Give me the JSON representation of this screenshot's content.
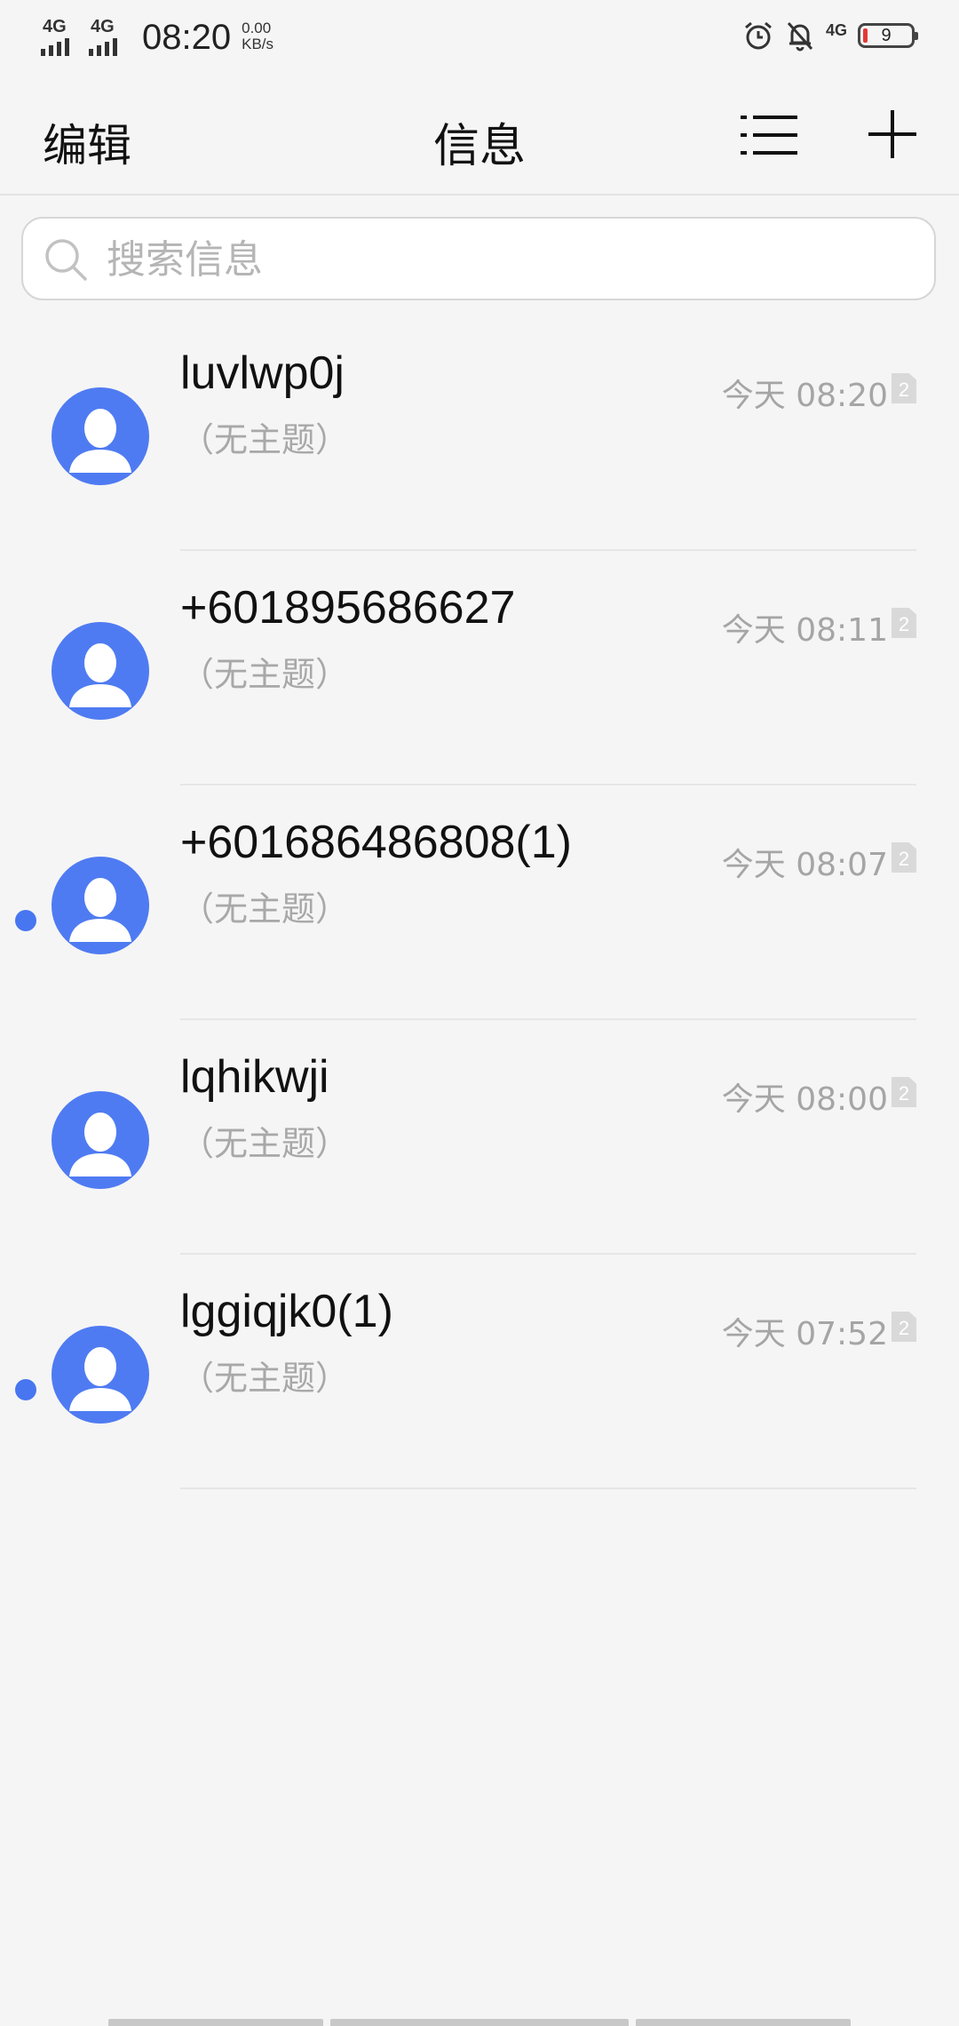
{
  "status_bar": {
    "sim1_network": "4G",
    "sim2_network": "4G",
    "time": "08:20",
    "speed_value": "0.00",
    "speed_unit": "KB/s",
    "right_network": "4G",
    "battery_level": "9",
    "icons": [
      "alarm-icon",
      "bell-off-icon",
      "signal-4g-icon",
      "battery-icon"
    ]
  },
  "header": {
    "edit_label": "编辑",
    "title": "信息",
    "menu_icon": "list-menu-icon",
    "add_icon": "plus-icon"
  },
  "search": {
    "placeholder": "搜索信息",
    "icon": "search-icon"
  },
  "colors": {
    "accent": "#4f7bf2",
    "unread_dot": "#4776f0",
    "background": "#f5f5f5"
  },
  "conversations": [
    {
      "name": "luvlwp0j",
      "subject": "（无主题）",
      "time": "今天 08:20",
      "sim": "2",
      "unread": false
    },
    {
      "name": "+601895686627",
      "subject": "（无主题）",
      "time": "今天 08:11",
      "sim": "2",
      "unread": false
    },
    {
      "name": "+601686486808(1)",
      "subject": "（无主题）",
      "time": "今天 08:07",
      "sim": "2",
      "unread": true
    },
    {
      "name": "lqhikwji",
      "subject": "（无主题）",
      "time": "今天 08:00",
      "sim": "2",
      "unread": false
    },
    {
      "name": "lggiqjk0(1)",
      "subject": "（无主题）",
      "time": "今天 07:52",
      "sim": "2",
      "unread": true
    }
  ]
}
